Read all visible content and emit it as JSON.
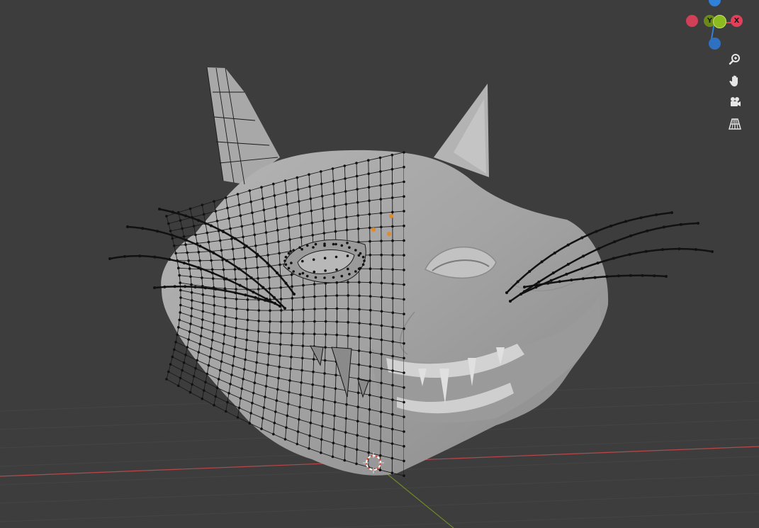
{
  "app": "Blender",
  "viewport": {
    "background": "#3d3d3d",
    "mode": "edit-mode-mesh",
    "object": "cat-head"
  },
  "gizmo": {
    "axes": [
      {
        "id": "x",
        "label": "X",
        "color": "#e2405a"
      },
      {
        "id": "y",
        "label": "Y",
        "color": "#8bbb1e"
      },
      {
        "id": "z",
        "label": "",
        "color": "#2f80d6"
      },
      {
        "id": "neg-x",
        "label": "",
        "color": "#e2405a"
      },
      {
        "id": "neg-y",
        "label": "",
        "color": "#6c8a1a"
      },
      {
        "id": "neg-z",
        "label": "",
        "color": "#3b70ad"
      }
    ]
  },
  "navigation": [
    {
      "id": "zoom",
      "icon": "zoom-icon"
    },
    {
      "id": "pan",
      "icon": "hand-icon"
    },
    {
      "id": "camera",
      "icon": "camera-icon"
    },
    {
      "id": "perspective",
      "icon": "grid-icon"
    }
  ],
  "colors": {
    "axis_x": "#b8484b",
    "axis_y": "#6e8a2a",
    "mesh_fill": "#a0a0a0",
    "wire": "#1a1a1a",
    "selected_vertex": "#e08a2a",
    "cursor": "#e24a3a"
  }
}
